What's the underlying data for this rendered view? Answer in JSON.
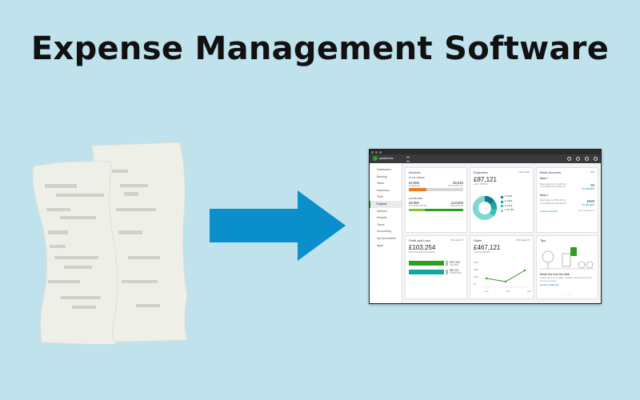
{
  "page": {
    "title": "Expense Management Software"
  },
  "colors": {
    "background": "#bfe2ec",
    "arrow": "#0b8fcb",
    "receipt": "#eef0e8",
    "brand_green": "#2ca01c",
    "teal": "#12a7a0",
    "orange": "#f07b1f"
  },
  "app": {
    "brand": "quickbooks",
    "top_icons": [
      "plus-icon",
      "search-icon",
      "gear-icon",
      "help-icon"
    ],
    "sidebar": [
      {
        "label": "Dashboard"
      },
      {
        "label": "Banking"
      },
      {
        "label": "Sales"
      },
      {
        "label": "Expenses"
      },
      {
        "label": "Time"
      },
      {
        "label": "Projects"
      },
      {
        "label": "Workers"
      },
      {
        "label": "Reports"
      },
      {
        "label": "Taxes"
      },
      {
        "label": "Accounting"
      },
      {
        "label": "My Accountant"
      },
      {
        "label": "Apps"
      }
    ],
    "active_nav": "Projects",
    "invoices": {
      "title": "Invoices",
      "unpaid_label": "£7,141 UNPAID",
      "overdue_amount": "£2,006",
      "overdue_label": "OVERDUE",
      "not_due_amount": "£5,543",
      "not_due_label": "NOT DUE YET",
      "paid_label": "£19,660 PAID",
      "deposited_amount": "£6,000",
      "deposited_label": "NOT DEPOSITED",
      "deposited2_amount": "£13,600",
      "deposited2_label": "DEPOSITED"
    },
    "expenses": {
      "title": "Expenses",
      "filter": "Last month",
      "total": "£87,121",
      "subtitle": "LAST MONTH",
      "legend": [
        {
          "amount": "£ 1,356",
          "color": "#0e7c86"
        },
        {
          "amount": "£ 7,654",
          "color": "#12a7a0"
        },
        {
          "amount": "£ 6,342",
          "color": "#34c0b3"
        },
        {
          "amount": "£ 74,789",
          "color": "#7fd9cf"
        }
      ]
    },
    "bank": {
      "title": "Bank accounts",
      "edit": "Edit",
      "accounts": [
        {
          "name": "Bank 1",
          "bank_label": "Bank balance",
          "bank_value": "£ 12,637.44",
          "qb_label": "In QuickBooks",
          "qb_value": "£4,987.50",
          "count": "94",
          "status": "TO REVIEW"
        },
        {
          "name": "Bank 2",
          "bank_label": "Bank balance",
          "bank_value": "£88,490.23",
          "qb_label": "In QuickBooks",
          "qb_value": "£65,997.80",
          "count": "£020",
          "status": "TO REVIEW"
        }
      ],
      "connect": "Connect accounts",
      "go_to": "Go to registers ▾"
    },
    "profit_loss": {
      "title": "Profit and Loss",
      "filter": "This month ▾",
      "total": "£103,254",
      "subtitle": "NET INCOME FOR APRIL",
      "income": "£707,212",
      "income_label": "INCOME",
      "expenses": "£87,121",
      "expenses_label": "EXPENSES"
    },
    "sales": {
      "title": "Sales",
      "filter": "This quarter ▾",
      "total": "£467,121",
      "subtitle": "THIS QUARTER",
      "y_ticks": [
        "£40K",
        "£30K",
        "£20K",
        "£0"
      ],
      "months": [
        "Jan",
        "Feb",
        "Mar"
      ]
    },
    "tips": {
      "title": "Tips",
      "headline": "Break free from the desk",
      "body": "Snap photos of receipts, manage invoices and more from your phone.",
      "link": "Get the mobile app"
    }
  }
}
